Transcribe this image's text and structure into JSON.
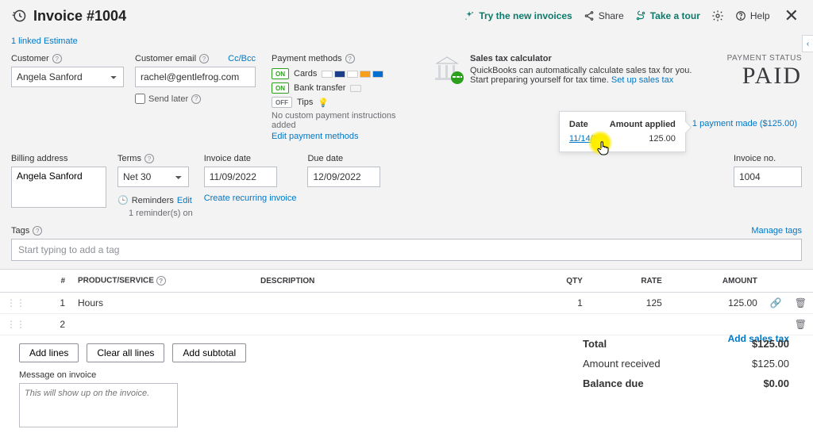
{
  "header": {
    "title": "Invoice #1004",
    "actions": {
      "try_new": "Try the new invoices",
      "share": "Share",
      "tour": "Take a tour",
      "help": "Help"
    }
  },
  "linked_text": "1 linked Estimate",
  "customer": {
    "label": "Customer",
    "value": "Angela Sanford",
    "email_label": "Customer email",
    "email_value": "rachel@gentlefrog.com",
    "ccbcc": "Cc/Bcc",
    "send_later": "Send later"
  },
  "payment_methods": {
    "label": "Payment methods",
    "cards": "Cards",
    "bank": "Bank transfer",
    "tips": "Tips",
    "note": "No custom payment instructions added",
    "edit": "Edit payment methods"
  },
  "sales_tax": {
    "heading": "Sales tax calculator",
    "body_1": "QuickBooks can automatically calculate sales tax for you. Start preparing yourself for tax time. ",
    "link": "Set up sales tax"
  },
  "status": {
    "label": "PAYMENT STATUS",
    "value": "PAID"
  },
  "payment_pop": {
    "col1": "Date",
    "col2": "Amount applied",
    "date": "11/14/20",
    "amount": "125.00",
    "link": "1 payment made ($125.00)"
  },
  "fields": {
    "billing_label": "Billing address",
    "billing_value": "Angela Sanford",
    "terms_label": "Terms",
    "terms_value": "Net 30",
    "inv_date_label": "Invoice date",
    "inv_date_value": "11/09/2022",
    "due_date_label": "Due date",
    "due_date_value": "12/09/2022",
    "create_recurring": "Create recurring invoice",
    "reminders_label": "Reminders",
    "reminders_edit": "Edit",
    "reminders_count": "1 reminder(s) on",
    "invno_label": "Invoice no.",
    "invno_value": "1004"
  },
  "tags": {
    "label": "Tags",
    "manage": "Manage tags",
    "placeholder": "Start typing to add a tag"
  },
  "table": {
    "headers": {
      "num": "#",
      "prod": "PRODUCT/SERVICE",
      "desc": "DESCRIPTION",
      "qty": "QTY",
      "rate": "RATE",
      "amount": "AMOUNT"
    },
    "rows": [
      {
        "n": "1",
        "prod": "Hours",
        "desc": "",
        "qty": "1",
        "rate": "125",
        "amount": "125.00"
      },
      {
        "n": "2",
        "prod": "",
        "desc": "",
        "qty": "",
        "rate": "",
        "amount": ""
      }
    ]
  },
  "buttons": {
    "add_lines": "Add lines",
    "clear": "Clear all lines",
    "subtotal": "Add subtotal"
  },
  "message": {
    "label": "Message on invoice",
    "placeholder": "This will show up on the invoice."
  },
  "add_sales_tax": "Add sales tax",
  "totals": {
    "total_l": "Total",
    "total_v": "$125.00",
    "recv_l": "Amount received",
    "recv_v": "$125.00",
    "bal_l": "Balance due",
    "bal_v": "$0.00"
  }
}
